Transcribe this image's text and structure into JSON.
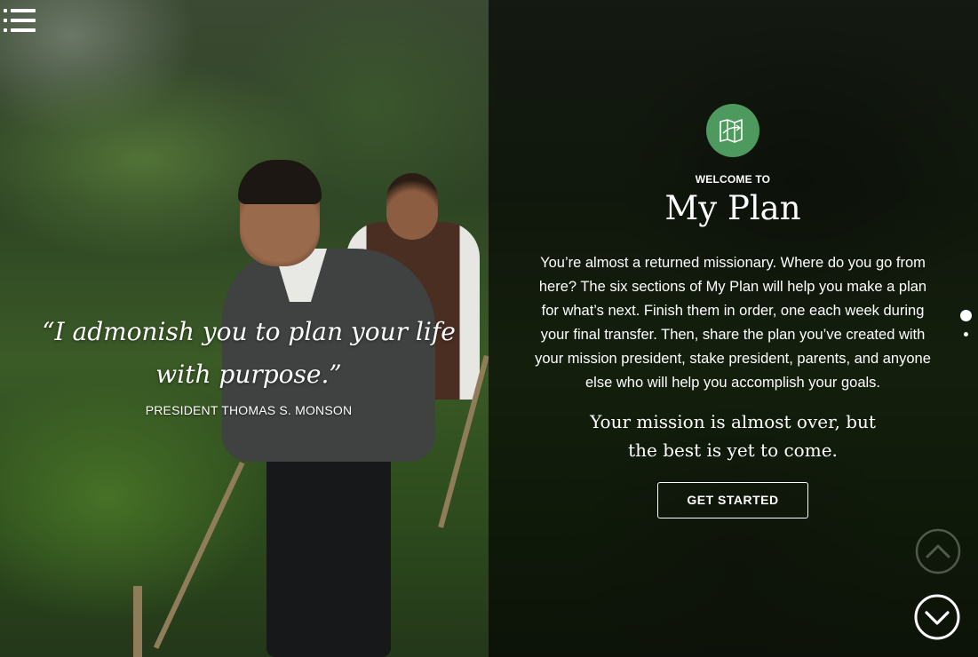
{
  "menu": {
    "icon": "hamburger-menu-icon"
  },
  "quote": {
    "line1": "“I admonish you to plan your life",
    "line2": "with purpose.”",
    "author": "PRESIDENT THOMAS S. MONSON"
  },
  "intro": {
    "logo_icon": "map-icon",
    "logo_color": "#4e9a5e",
    "welcome": "WELCOME TO",
    "title": "My Plan",
    "description": "You’re almost a returned missionary. Where do you go from here? The six sections of My Plan will help you make a plan for what’s next. Finish them in order, one each week during your final transfer. Then, share the plan you’ve created with your mission president, stake president, parents, and anyone else who will help you accomplish your goals.",
    "tagline": "Your mission is almost over, but the best is yet to come.",
    "cta_label": "GET STARTED"
  },
  "pagination": {
    "total": 2,
    "active": 1
  },
  "nav": {
    "up_icon": "chevron-up-circle-icon",
    "down_icon": "chevron-down-circle-icon"
  }
}
